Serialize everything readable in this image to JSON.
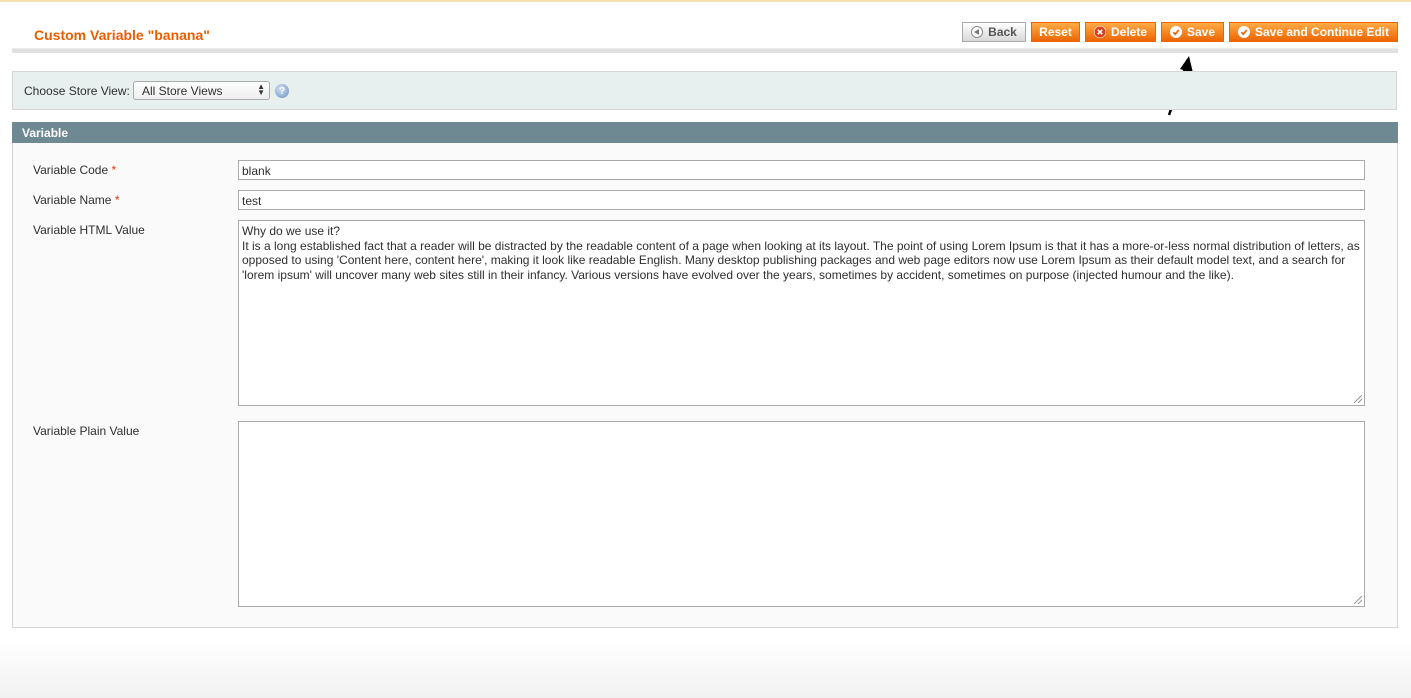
{
  "page": {
    "title": "Custom Variable \"banana\""
  },
  "toolbar": {
    "back_label": "Back",
    "reset_label": "Reset",
    "delete_label": "Delete",
    "save_label": "Save",
    "save_continue_label": "Save and Continue Edit"
  },
  "store_switcher": {
    "label": "Choose Store View:",
    "selected": "All Store Views",
    "help_icon": "question-circle-icon"
  },
  "section": {
    "title": "Variable"
  },
  "fields": {
    "code": {
      "label": "Variable Code",
      "required_mark": "*",
      "value": "blank"
    },
    "name": {
      "label": "Variable Name",
      "required_mark": "*",
      "value": "test"
    },
    "html_value": {
      "label": "Variable HTML Value",
      "line1": "Why do we use it?",
      "line2": "It is a long established fact that a reader will be distracted by the readable content of a page when looking at its layout. The point of using Lorem Ipsum is that it has a more-or-less normal distribution of letters, as opposed to using 'Content here, content here', making it look like readable English. Many desktop publishing packages and web page editors now use Lorem Ipsum as their default model text, and a search for 'lorem ipsum' will uncover many web sites still in their infancy. Various versions have evolved over the years, sometimes by accident, sometimes on purpose (injected humour and the like)."
    },
    "plain_value": {
      "label": "Variable Plain Value",
      "value": ""
    }
  },
  "colors": {
    "accent": "#eb5e00",
    "button_orange": "#ed6502",
    "section_header": "#6f8992",
    "required": "#eb340a"
  }
}
